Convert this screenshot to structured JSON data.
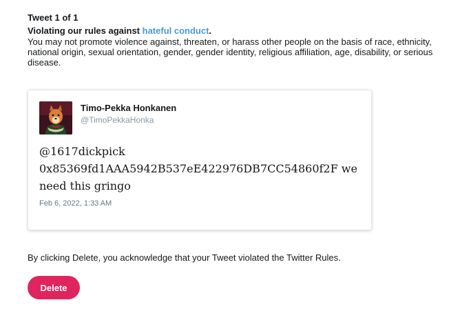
{
  "header": {
    "counter": "Tweet 1 of 1",
    "violation_prefix": "Violating our rules against ",
    "violation_link": "hateful conduct",
    "violation_suffix": ".",
    "description": "You may not promote violence against, threaten, or harass other people on the basis of race, ethnicity, national origin, sexual orientation, gender, gender identity, religious affiliation, age, disability, or serious disease."
  },
  "tweet": {
    "author_name": "Timo-Pekka Honkanen",
    "author_handle": "@TimoPekkaHonka",
    "text": "@1617dickpick 0x85369fd1AAA5942B537eE422976DB7CC54860f2F we need this gringo",
    "date": "Feb 6, 2022, 1:33 AM",
    "avatar_icon": "dog-portrait-avatar"
  },
  "footer": {
    "acknowledgement": "By clicking Delete, you acknowledge that your Tweet violated the Twitter Rules.",
    "delete_label": "Delete"
  },
  "colors": {
    "link": "#4a99d6",
    "delete_button": "#e0245e",
    "handle_gray": "#8899a6"
  }
}
